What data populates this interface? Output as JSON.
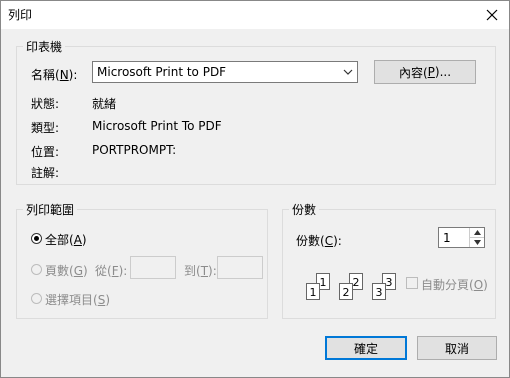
{
  "window": {
    "title": "列印"
  },
  "printer_group": {
    "legend": "印表機",
    "name_label_pre": "名稱(",
    "name_label_key": "N",
    "name_label_post": "):",
    "selected_printer": "Microsoft Print to PDF",
    "properties_pre": "內容(",
    "properties_key": "P",
    "properties_post": ")...",
    "status_label": "狀態:",
    "status_value": "就緒",
    "type_label": "類型:",
    "type_value": "Microsoft Print To PDF",
    "location_label": "位置:",
    "location_value": "PORTPROMPT:",
    "comment_label": "註解:"
  },
  "range_group": {
    "legend": "列印範圍",
    "all_pre": "全部(",
    "all_key": "A",
    "all_post": ")",
    "pages_pre": "頁數(",
    "pages_key": "G",
    "pages_post": ")",
    "from_pre": "從(",
    "from_key": "F",
    "from_post": "):",
    "to_pre": "到(",
    "to_key": "T",
    "to_post": "):",
    "selection_pre": "選擇項目(",
    "selection_key": "S",
    "selection_post": ")"
  },
  "copies_group": {
    "legend": "份數",
    "copies_pre": "份數(",
    "copies_key": "C",
    "copies_post": "):",
    "copies_value": "1",
    "collate_pre": "自動分頁(",
    "collate_key": "O",
    "collate_post": ")",
    "collate_pages": [
      "1",
      "1",
      "2",
      "2",
      "3",
      "3"
    ]
  },
  "buttons": {
    "ok": "確定",
    "cancel": "取消"
  }
}
